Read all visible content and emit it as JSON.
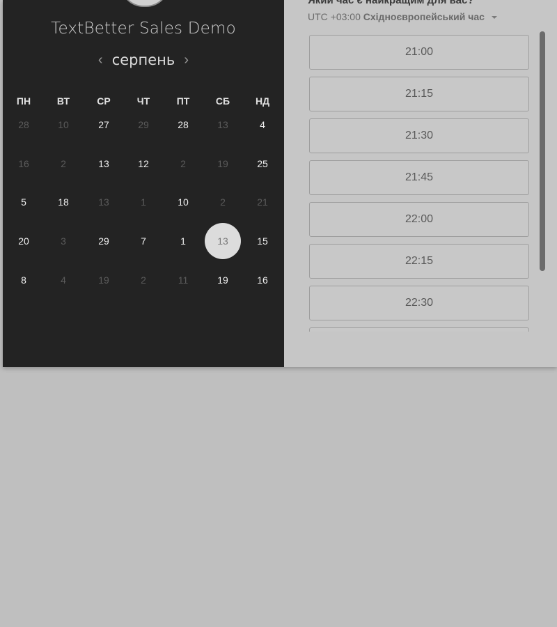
{
  "calendar": {
    "company_name": "TextBetter Sales Demo",
    "month": "серпень",
    "prev_arrow": "‹",
    "next_arrow": "›",
    "weekdays": [
      "ПН",
      "ВТ",
      "СР",
      "ЧТ",
      "ПТ",
      "СБ",
      "НД"
    ],
    "weeks": [
      [
        {
          "d": "28",
          "s": "muted"
        },
        {
          "d": "10",
          "s": "muted"
        },
        {
          "d": "27",
          "s": "active"
        },
        {
          "d": "29",
          "s": "muted"
        },
        {
          "d": "28",
          "s": "active"
        },
        {
          "d": "13",
          "s": "muted"
        },
        {
          "d": "4",
          "s": "active"
        }
      ],
      [
        {
          "d": "16",
          "s": "muted"
        },
        {
          "d": "2",
          "s": "muted"
        },
        {
          "d": "13",
          "s": "active"
        },
        {
          "d": "12",
          "s": "active"
        },
        {
          "d": "2",
          "s": "muted"
        },
        {
          "d": "19",
          "s": "muted"
        },
        {
          "d": "25",
          "s": "active"
        }
      ],
      [
        {
          "d": "5",
          "s": "active"
        },
        {
          "d": "18",
          "s": "active"
        },
        {
          "d": "13",
          "s": "muted"
        },
        {
          "d": "1",
          "s": "muted"
        },
        {
          "d": "10",
          "s": "active"
        },
        {
          "d": "2",
          "s": "muted"
        },
        {
          "d": "21",
          "s": "muted"
        }
      ],
      [
        {
          "d": "20",
          "s": "active"
        },
        {
          "d": "3",
          "s": "muted"
        },
        {
          "d": "29",
          "s": "active"
        },
        {
          "d": "7",
          "s": "active"
        },
        {
          "d": "1",
          "s": "active"
        },
        {
          "d": "13",
          "s": "selected"
        },
        {
          "d": "15",
          "s": "active"
        }
      ],
      [
        {
          "d": "8",
          "s": "active"
        },
        {
          "d": "4",
          "s": "muted"
        },
        {
          "d": "19",
          "s": "muted"
        },
        {
          "d": "2",
          "s": "muted"
        },
        {
          "d": "11",
          "s": "muted"
        },
        {
          "d": "19",
          "s": "active"
        },
        {
          "d": "16",
          "s": "active"
        }
      ]
    ]
  },
  "scheduler": {
    "question": "Який час є найкращим для вас?",
    "timezone_offset": "UTC +03:00",
    "timezone_name": "Східноєвропейський час",
    "slots": [
      "21:00",
      "21:15",
      "21:30",
      "21:45",
      "22:00",
      "22:15",
      "22:30",
      ""
    ]
  },
  "colors": {
    "left_panel_bg": "#232323",
    "right_panel_bg": "#c6c6c6",
    "page_bg": "#bfbfbf",
    "selected_day_bg": "#dcdcdc"
  }
}
